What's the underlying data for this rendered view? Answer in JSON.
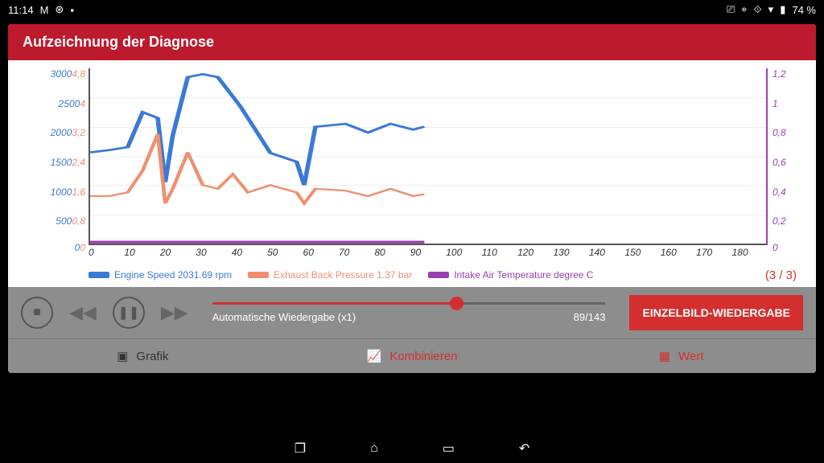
{
  "status": {
    "time": "11:14",
    "battery": "74 %"
  },
  "header": {
    "title": "Aufzeichnung der Diagnose"
  },
  "chart_data": {
    "type": "line",
    "xlim": [
      0,
      180
    ],
    "x_ticks": [
      0,
      10,
      20,
      30,
      40,
      50,
      60,
      70,
      80,
      90,
      100,
      110,
      120,
      130,
      140,
      150,
      160,
      170,
      180
    ],
    "axes": [
      {
        "name": "Engine Speed",
        "unit": "rpm",
        "color": "#3a7ad6",
        "range": [
          0,
          3000
        ],
        "ticks": [
          0,
          500,
          1000,
          1500,
          2000,
          2500,
          3000
        ]
      },
      {
        "name": "Exhaust Back Pressure",
        "unit": "bar",
        "color": "#f08f70",
        "range": [
          0,
          4.8
        ],
        "ticks": [
          0,
          0.8,
          1.6,
          2.4,
          3.2,
          4,
          4.8
        ]
      },
      {
        "name": "Intake Air Temperature",
        "unit": "degree C",
        "color": "#9b3fb0",
        "range": [
          0,
          1.2
        ],
        "ticks": [
          0,
          0.2,
          0.4,
          0.6,
          0.8,
          1,
          1.2
        ]
      }
    ],
    "series": [
      {
        "name": "Engine Speed",
        "axis": 0,
        "current_value": "2031.69 rpm",
        "x": [
          0,
          5,
          10,
          14,
          18,
          20,
          22,
          26,
          30,
          34,
          40,
          48,
          55,
          57,
          60,
          68,
          74,
          80,
          86,
          89
        ],
        "values": [
          1560,
          1600,
          1650,
          2250,
          2150,
          1050,
          1850,
          2850,
          2900,
          2850,
          2350,
          1550,
          1400,
          1000,
          2000,
          2050,
          1900,
          2050,
          1950,
          2000
        ]
      },
      {
        "name": "Exhaust Back Pressure",
        "axis": 1,
        "current_value": "1.37 bar",
        "x": [
          0,
          5,
          10,
          14,
          18,
          20,
          22,
          26,
          30,
          34,
          38,
          42,
          48,
          55,
          57,
          60,
          68,
          74,
          80,
          86,
          89
        ],
        "values": [
          1.3,
          1.3,
          1.4,
          2.0,
          3.0,
          1.1,
          1.5,
          2.5,
          1.6,
          1.5,
          1.9,
          1.4,
          1.6,
          1.4,
          1.1,
          1.5,
          1.45,
          1.3,
          1.5,
          1.3,
          1.35
        ]
      },
      {
        "name": "Intake Air Temperature",
        "axis": 2,
        "current_value": "",
        "x": [
          0,
          89
        ],
        "values": [
          0.01,
          0.01
        ]
      }
    ]
  },
  "legend": [
    {
      "label": "Engine Speed 2031.69 rpm",
      "color": "#3a7ad6"
    },
    {
      "label": "Exhaust Back Pressure 1.37 bar",
      "color": "#f08f70"
    },
    {
      "label": "Intake Air Temperature  degree C",
      "color": "#9b3fb0"
    }
  ],
  "page_indicator": "(3 / 3)",
  "playback": {
    "mode_label": "Automatische Wiedergabe (x1)",
    "position_label": "89/143",
    "position_pct": 62,
    "frame_button": "EINZELBILD-WIEDERGABE"
  },
  "tabs": {
    "grafik": "Grafik",
    "kombinieren": "Kombinieren",
    "wert": "Wert"
  }
}
